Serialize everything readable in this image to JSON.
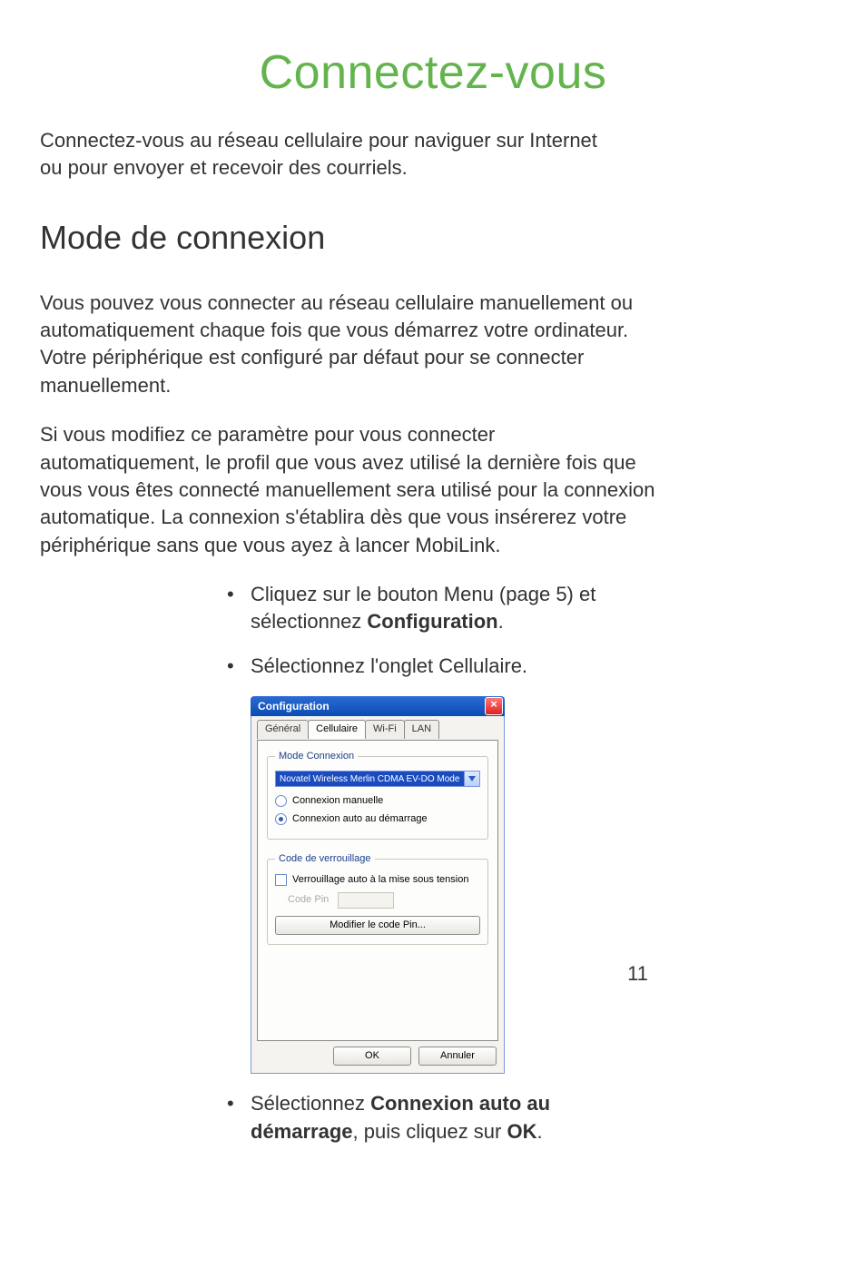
{
  "doc": {
    "title": "Connectez-vous",
    "intro": "Connectez-vous au réseau cellulaire pour naviguer sur Internet ou pour envoyer et recevoir des courriels.",
    "section_title": "Mode de connexion",
    "para1": "Vous pouvez vous connecter au réseau cellulaire manuellement ou automatiquement chaque fois que vous démarrez votre ordinateur. Votre périphérique est configuré par défaut pour se connecter manuellement.",
    "para2": "Si vous modifiez ce paramètre pour vous connecter automatiquement, le profil que vous avez utilisé la dernière fois que vous vous êtes connecté manuellement sera utilisé pour la connexion automatique. La connexion s'établira dès que vous insérerez votre périphérique sans que vous ayez à lancer MobiLink.",
    "step1_pre": "Cliquez sur le bouton Menu (page 5) et sélectionnez ",
    "step1_bold": "Configuration",
    "step1_post": ".",
    "step2": "Sélectionnez l'onglet Cellulaire.",
    "step3_pre": "Sélectionnez ",
    "step3_bold1": "Connexion auto au démarrage",
    "step3_mid": ", puis cliquez sur ",
    "step3_bold2": "OK",
    "step3_post": ".",
    "page_number": "11"
  },
  "dialog": {
    "title": "Configuration",
    "close_glyph": "×",
    "tabs": {
      "general": "Général",
      "cellulaire": "Cellulaire",
      "wifi": "Wi-Fi",
      "lan": "LAN"
    },
    "group_mode": {
      "legend": "Mode Connexion",
      "dropdown_value": "Novatel Wireless Merlin CDMA EV-DO Mode",
      "radio_manual": "Connexion manuelle",
      "radio_auto": "Connexion auto au démarrage"
    },
    "group_lock": {
      "legend": "Code de verrouillage",
      "checkbox_label": "Verrouillage auto à la mise sous tension",
      "pin_label": "Code Pin",
      "modify_btn": "Modifier le code Pin..."
    },
    "ok": "OK",
    "cancel": "Annuler"
  }
}
